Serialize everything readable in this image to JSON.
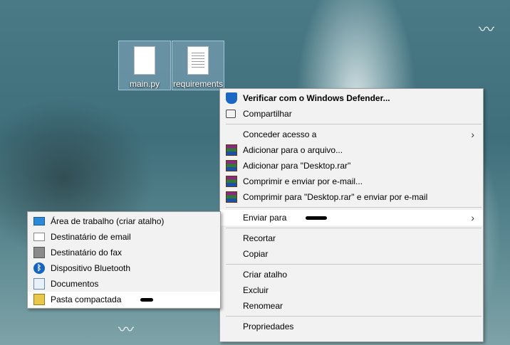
{
  "desktop": {
    "icons": [
      {
        "label": "main.py",
        "icon": "file-icon"
      },
      {
        "label": "requirements",
        "icon": "text-file-icon"
      }
    ]
  },
  "context_menu": {
    "items": [
      {
        "label": "Verificar com o Windows Defender...",
        "icon": "windows-defender-icon"
      },
      {
        "label": "Compartilhar",
        "icon": "share-icon"
      },
      {
        "label": "Conceder acesso a",
        "icon": ""
      },
      {
        "label": "Adicionar para o arquivo...",
        "icon": "winrar-icon"
      },
      {
        "label": "Adicionar para \"Desktop.rar\"",
        "icon": "winrar-icon"
      },
      {
        "label": "Comprimir e enviar por e-mail...",
        "icon": "winrar-icon"
      },
      {
        "label": "Comprimir para \"Desktop.rar\" e enviar por e-mail",
        "icon": "winrar-icon"
      },
      {
        "label": "Enviar para",
        "icon": ""
      },
      {
        "label": "Recortar",
        "icon": ""
      },
      {
        "label": "Copiar",
        "icon": ""
      },
      {
        "label": "Criar atalho",
        "icon": ""
      },
      {
        "label": "Excluir",
        "icon": ""
      },
      {
        "label": "Renomear",
        "icon": ""
      },
      {
        "label": "Propriedades",
        "icon": ""
      }
    ],
    "submenu_arrow": "›"
  },
  "send_to_menu": {
    "items": [
      {
        "label": "Área de trabalho (criar atalho)",
        "icon": "desktop-monitor-icon"
      },
      {
        "label": "Destinatário de email",
        "icon": "mail-recipient-icon"
      },
      {
        "label": "Destinatário do fax",
        "icon": "fax-icon"
      },
      {
        "label": "Dispositivo Bluetooth",
        "icon": "bluetooth-icon"
      },
      {
        "label": "Documentos",
        "icon": "documents-icon"
      },
      {
        "label": "Pasta compactada",
        "icon": "zip-folder-icon"
      }
    ]
  },
  "colors": {
    "menu_background": "#f2f2f2",
    "menu_highlight": "#ffffff",
    "menu_border": "#a0a0a0"
  }
}
